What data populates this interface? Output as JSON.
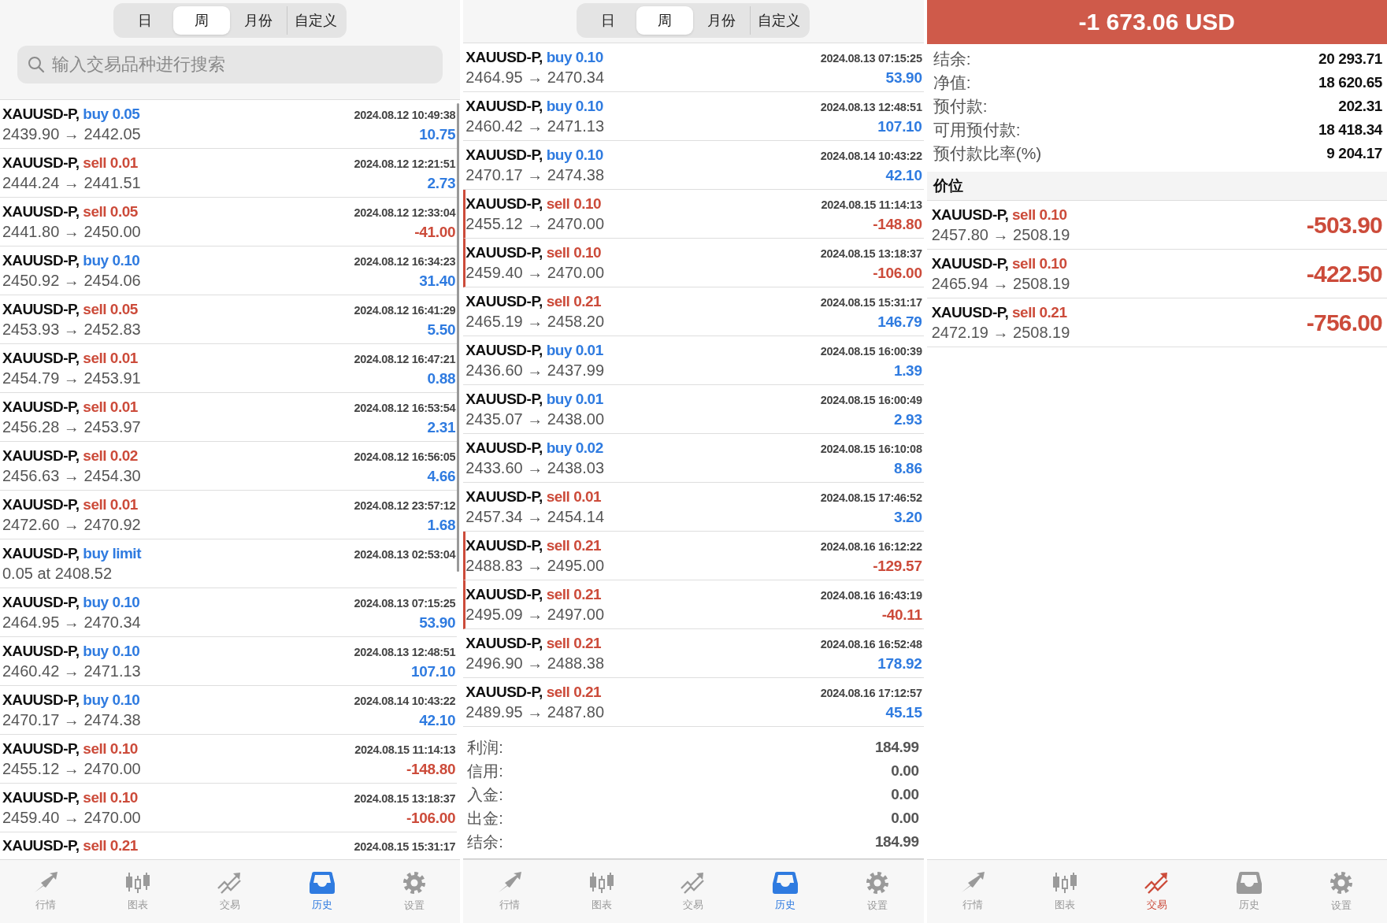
{
  "panels": [
    {
      "segments": [
        {
          "label": "日",
          "selected": false
        },
        {
          "label": "周",
          "selected": true
        },
        {
          "label": "月份",
          "selected": false
        },
        {
          "label": "自定义",
          "selected": false
        }
      ],
      "search": {
        "placeholder": "输入交易品种进行搜索"
      },
      "scrollbar": true,
      "trades": [
        {
          "symbol": "XAUUSD-P,",
          "order": "buy 0.05",
          "kind": "buy",
          "time": "2024.08.12 10:49:38",
          "detail": "2439.90 → 2442.05",
          "profit": "10.75",
          "negative": false,
          "marked": false
        },
        {
          "symbol": "XAUUSD-P,",
          "order": "sell 0.01",
          "kind": "sell",
          "time": "2024.08.12 12:21:51",
          "detail": "2444.24 → 2441.51",
          "profit": "2.73",
          "negative": false,
          "marked": false
        },
        {
          "symbol": "XAUUSD-P,",
          "order": "sell 0.05",
          "kind": "sell",
          "time": "2024.08.12 12:33:04",
          "detail": "2441.80 → 2450.00",
          "profit": "-41.00",
          "negative": true,
          "marked": false
        },
        {
          "symbol": "XAUUSD-P,",
          "order": "buy 0.10",
          "kind": "buy",
          "time": "2024.08.12 16:34:23",
          "detail": "2450.92 → 2454.06",
          "profit": "31.40",
          "negative": false,
          "marked": false
        },
        {
          "symbol": "XAUUSD-P,",
          "order": "sell 0.05",
          "kind": "sell",
          "time": "2024.08.12 16:41:29",
          "detail": "2453.93 → 2452.83",
          "profit": "5.50",
          "negative": false,
          "marked": false
        },
        {
          "symbol": "XAUUSD-P,",
          "order": "sell 0.01",
          "kind": "sell",
          "time": "2024.08.12 16:47:21",
          "detail": "2454.79 → 2453.91",
          "profit": "0.88",
          "negative": false,
          "marked": false
        },
        {
          "symbol": "XAUUSD-P,",
          "order": "sell 0.01",
          "kind": "sell",
          "time": "2024.08.12 16:53:54",
          "detail": "2456.28 → 2453.97",
          "profit": "2.31",
          "negative": false,
          "marked": false
        },
        {
          "symbol": "XAUUSD-P,",
          "order": "sell 0.02",
          "kind": "sell",
          "time": "2024.08.12 16:56:05",
          "detail": "2456.63 → 2454.30",
          "profit": "4.66",
          "negative": false,
          "marked": false
        },
        {
          "symbol": "XAUUSD-P,",
          "order": "sell 0.01",
          "kind": "sell",
          "time": "2024.08.12 23:57:12",
          "detail": "2472.60 → 2470.92",
          "profit": "1.68",
          "negative": false,
          "marked": false
        },
        {
          "symbol": "XAUUSD-P,",
          "order": "buy limit",
          "kind": "buy",
          "time": "2024.08.13 02:53:04",
          "detail": "0.05 at 2408.52",
          "marked": false
        },
        {
          "symbol": "XAUUSD-P,",
          "order": "buy 0.10",
          "kind": "buy",
          "time": "2024.08.13 07:15:25",
          "detail": "2464.95 → 2470.34",
          "profit": "53.90",
          "negative": false,
          "marked": false
        },
        {
          "symbol": "XAUUSD-P,",
          "order": "buy 0.10",
          "kind": "buy",
          "time": "2024.08.13 12:48:51",
          "detail": "2460.42 → 2471.13",
          "profit": "107.10",
          "negative": false,
          "marked": false
        },
        {
          "symbol": "XAUUSD-P,",
          "order": "buy 0.10",
          "kind": "buy",
          "time": "2024.08.14 10:43:22",
          "detail": "2470.17 → 2474.38",
          "profit": "42.10",
          "negative": false,
          "marked": false
        },
        {
          "symbol": "XAUUSD-P,",
          "order": "sell 0.10",
          "kind": "sell",
          "time": "2024.08.15 11:14:13",
          "detail": "2455.12 → 2470.00",
          "profit": "-148.80",
          "negative": true,
          "marked": false
        },
        {
          "symbol": "XAUUSD-P,",
          "order": "sell 0.10",
          "kind": "sell",
          "time": "2024.08.15 13:18:37",
          "detail": "2459.40 → 2470.00",
          "profit": "-106.00",
          "negative": true,
          "marked": false
        },
        {
          "symbol": "XAUUSD-P,",
          "order": "sell 0.21",
          "kind": "sell",
          "time": "2024.08.15 15:31:17",
          "marked": false
        }
      ],
      "nav": [
        {
          "label": "行情",
          "kind": "quotes",
          "selected": false
        },
        {
          "label": "图表",
          "kind": "chart",
          "selected": false
        },
        {
          "label": "交易",
          "kind": "trade",
          "selected": false
        },
        {
          "label": "历史",
          "kind": "history",
          "selected": true
        },
        {
          "label": "设置",
          "kind": "settings",
          "selected": false
        }
      ]
    },
    {
      "segments": [
        {
          "label": "日",
          "selected": false
        },
        {
          "label": "周",
          "selected": true
        },
        {
          "label": "月份",
          "selected": false
        },
        {
          "label": "自定义",
          "selected": false
        }
      ],
      "trades": [
        {
          "symbol": "XAUUSD-P,",
          "order": "buy 0.10",
          "kind": "buy",
          "time": "2024.08.13 07:15:25",
          "detail": "2464.95 → 2470.34",
          "profit": "53.90",
          "negative": false,
          "marked": false
        },
        {
          "symbol": "XAUUSD-P,",
          "order": "buy 0.10",
          "kind": "buy",
          "time": "2024.08.13 12:48:51",
          "detail": "2460.42 → 2471.13",
          "profit": "107.10",
          "negative": false,
          "marked": false
        },
        {
          "symbol": "XAUUSD-P,",
          "order": "buy 0.10",
          "kind": "buy",
          "time": "2024.08.14 10:43:22",
          "detail": "2470.17 → 2474.38",
          "profit": "42.10",
          "negative": false,
          "marked": false
        },
        {
          "symbol": "XAUUSD-P,",
          "order": "sell 0.10",
          "kind": "sell",
          "time": "2024.08.15 11:14:13",
          "detail": "2455.12 → 2470.00",
          "profit": "-148.80",
          "negative": true,
          "marked": true
        },
        {
          "symbol": "XAUUSD-P,",
          "order": "sell 0.10",
          "kind": "sell",
          "time": "2024.08.15 13:18:37",
          "detail": "2459.40 → 2470.00",
          "profit": "-106.00",
          "negative": true,
          "marked": true
        },
        {
          "symbol": "XAUUSD-P,",
          "order": "sell 0.21",
          "kind": "sell",
          "time": "2024.08.15 15:31:17",
          "detail": "2465.19 → 2458.20",
          "profit": "146.79",
          "negative": false,
          "marked": false
        },
        {
          "symbol": "XAUUSD-P,",
          "order": "buy 0.01",
          "kind": "buy",
          "time": "2024.08.15 16:00:39",
          "detail": "2436.60 → 2437.99",
          "profit": "1.39",
          "negative": false,
          "marked": false
        },
        {
          "symbol": "XAUUSD-P,",
          "order": "buy 0.01",
          "kind": "buy",
          "time": "2024.08.15 16:00:49",
          "detail": "2435.07 → 2438.00",
          "profit": "2.93",
          "negative": false,
          "marked": false
        },
        {
          "symbol": "XAUUSD-P,",
          "order": "buy 0.02",
          "kind": "buy",
          "time": "2024.08.15 16:10:08",
          "detail": "2433.60 → 2438.03",
          "profit": "8.86",
          "negative": false,
          "marked": false
        },
        {
          "symbol": "XAUUSD-P,",
          "order": "sell 0.01",
          "kind": "sell",
          "time": "2024.08.15 17:46:52",
          "detail": "2457.34 → 2454.14",
          "profit": "3.20",
          "negative": false,
          "marked": false
        },
        {
          "symbol": "XAUUSD-P,",
          "order": "sell 0.21",
          "kind": "sell",
          "time": "2024.08.16 16:12:22",
          "detail": "2488.83 → 2495.00",
          "profit": "-129.57",
          "negative": true,
          "marked": true
        },
        {
          "symbol": "XAUUSD-P,",
          "order": "sell 0.21",
          "kind": "sell",
          "time": "2024.08.16 16:43:19",
          "detail": "2495.09 → 2497.00",
          "profit": "-40.11",
          "negative": true,
          "marked": true
        },
        {
          "symbol": "XAUUSD-P,",
          "order": "sell 0.21",
          "kind": "sell",
          "time": "2024.08.16 16:52:48",
          "detail": "2496.90 → 2488.38",
          "profit": "178.92",
          "negative": false,
          "marked": false
        },
        {
          "symbol": "XAUUSD-P,",
          "order": "sell 0.21",
          "kind": "sell",
          "time": "2024.08.16 17:12:57",
          "detail": "2489.95 → 2487.80",
          "profit": "45.15",
          "negative": false,
          "marked": false
        }
      ],
      "summary": [
        {
          "label": "利润:",
          "value": "184.99"
        },
        {
          "label": "信用:",
          "value": "0.00"
        },
        {
          "label": "入金:",
          "value": "0.00"
        },
        {
          "label": "出金:",
          "value": "0.00"
        },
        {
          "label": "结余:",
          "value": "184.99"
        }
      ],
      "nav": [
        {
          "label": "行情",
          "kind": "quotes",
          "selected": false
        },
        {
          "label": "图表",
          "kind": "chart",
          "selected": false
        },
        {
          "label": "交易",
          "kind": "trade",
          "selected": false
        },
        {
          "label": "历史",
          "kind": "history",
          "selected": true
        },
        {
          "label": "设置",
          "kind": "settings",
          "selected": false
        }
      ]
    },
    {
      "total": "-1 673.06 USD",
      "account": [
        {
          "label": "结余:",
          "value": "20 293.71"
        },
        {
          "label": "净值:",
          "value": "18 620.65"
        },
        {
          "label": "预付款:",
          "value": "202.31"
        },
        {
          "label": "可用预付款:",
          "value": "18 418.34"
        },
        {
          "label": "预付款比率(%)",
          "value": "9 204.17"
        }
      ],
      "section_title": "价位",
      "positions": [
        {
          "symbol": "XAUUSD-P,",
          "order": "sell 0.10",
          "kind": "sell",
          "detail": "2457.80 → 2508.19",
          "profit": "-503.90",
          "negative": true
        },
        {
          "symbol": "XAUUSD-P,",
          "order": "sell 0.10",
          "kind": "sell",
          "detail": "2465.94 → 2508.19",
          "profit": "-422.50",
          "negative": true
        },
        {
          "symbol": "XAUUSD-P,",
          "order": "sell 0.21",
          "kind": "sell",
          "detail": "2472.19 → 2508.19",
          "profit": "-756.00",
          "negative": true
        }
      ],
      "nav": [
        {
          "label": "行情",
          "kind": "quotes",
          "selected": false
        },
        {
          "label": "图表",
          "kind": "chart",
          "selected": false
        },
        {
          "label": "交易",
          "kind": "trade",
          "selected": true
        },
        {
          "label": "历史",
          "kind": "history",
          "selected": false
        },
        {
          "label": "设置",
          "kind": "settings",
          "selected": false
        }
      ]
    }
  ]
}
